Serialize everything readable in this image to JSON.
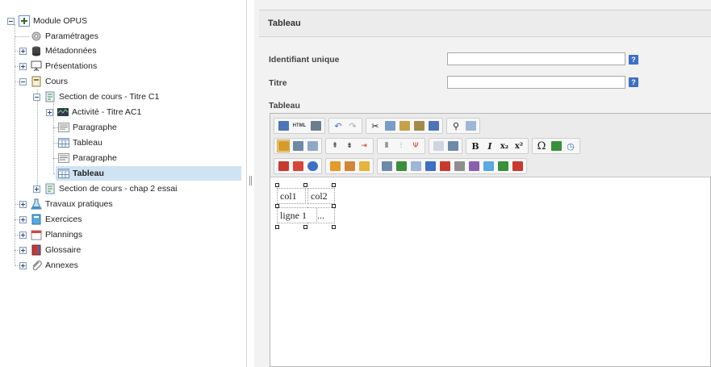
{
  "tree": {
    "root": "Module OPUS",
    "items": [
      {
        "label": "Paramétrages"
      },
      {
        "label": "Métadonnées"
      },
      {
        "label": "Présentations"
      },
      {
        "label": "Cours"
      },
      {
        "label": "Section de cours - Titre C1"
      },
      {
        "label": "Activité - Titre AC1"
      },
      {
        "label": "Paragraphe"
      },
      {
        "label": "Tableau"
      },
      {
        "label": "Paragraphe"
      },
      {
        "label": "Tableau",
        "selected": true
      },
      {
        "label": "Section de cours - chap 2 essai"
      },
      {
        "label": "Travaux pratiques"
      },
      {
        "label": "Exercices"
      },
      {
        "label": "Plannings"
      },
      {
        "label": "Glossaire"
      },
      {
        "label": "Annexes"
      }
    ]
  },
  "panel": {
    "title": "Tableau",
    "fields": [
      {
        "label": "Identifiant unique",
        "value": "",
        "help": "?"
      },
      {
        "label": "Titre",
        "value": "",
        "help": "?"
      }
    ],
    "editor_label": "Tableau"
  },
  "toolbar": {
    "html_label": "HTML",
    "bold": "B",
    "italic": "I",
    "subscript": "x₂",
    "superscript": "x²",
    "omega": "Ω",
    "icon_colors": {
      "blue": "#3d6fc6",
      "orange": "#e59a2a",
      "red": "#c9392f",
      "green": "#3a8f3a",
      "purple": "#8a5fb0",
      "gray": "#8e8e8e"
    }
  },
  "table": {
    "cells": [
      [
        "col1",
        "col2"
      ],
      [
        "ligne 1",
        "..."
      ]
    ]
  }
}
